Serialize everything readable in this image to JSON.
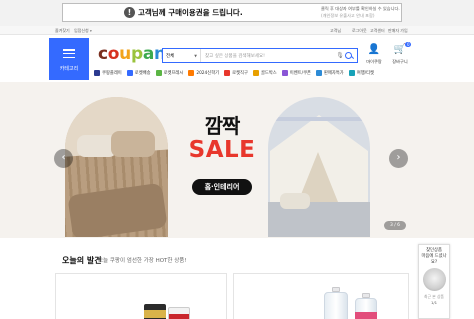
{
  "notice": {
    "icon": "!",
    "title": "고객님께 구매이용권을 드립니다.",
    "line1": "클릭 후 대상자 여부를 확인하실 수 있습니다.",
    "line2": "(개인정보 유출사고 안내 포함)"
  },
  "top_links": {
    "favorites": "즐겨찾기",
    "seller": "입점신청",
    "user": "고객님",
    "logout": "로그아웃",
    "customer_center": "고객센터",
    "seller_apply": "판매자 가입"
  },
  "header": {
    "category_label": "카테고리",
    "logo_letters": [
      {
        "ch": "c",
        "color": "#7a2e1e"
      },
      {
        "ch": "o",
        "color": "#d6301e"
      },
      {
        "ch": "u",
        "color": "#f2a31b"
      },
      {
        "ch": "p",
        "color": "#9ac33c"
      },
      {
        "ch": "a",
        "color": "#3daa50"
      },
      {
        "ch": "n",
        "color": "#2d8bd6"
      },
      {
        "ch": "g",
        "color": "#2d8bd6"
      }
    ],
    "search_select": "전체",
    "search_placeholder": "찾고 싶은 상품을 검색해보세요!",
    "my_label": "마이쿠팡",
    "cart_label": "장바구니",
    "cart_count": "0"
  },
  "quick_nav": [
    {
      "label": "쿠팡플레이",
      "color": "#2b3a8f"
    },
    {
      "label": "로켓배송",
      "color": "#346aff"
    },
    {
      "label": "로켓프레시",
      "color": "#5bb544"
    },
    {
      "label": "2024신학기",
      "color": "#ff7a00"
    },
    {
      "label": "로켓직구",
      "color": "#e8372c"
    },
    {
      "label": "골드박스",
      "color": "#e8a000"
    },
    {
      "label": "이벤트/쿠폰",
      "color": "#8a56d6"
    },
    {
      "label": "판매자특가",
      "color": "#2d8bd6"
    },
    {
      "label": "여행/티켓",
      "color": "#17a2b8"
    }
  ],
  "hero": {
    "title_kr": "깜짝",
    "title_en": "SALE",
    "tag": "홈·인테리어",
    "prev": "‹",
    "next": "›",
    "pager": "3 / 6",
    "sale_color": "#e8372c"
  },
  "discovery": {
    "title": "오늘의 발견",
    "subtitle": "오늘 쿠팡이 엄선한 가장 HOT한 상품!"
  },
  "side_panel": {
    "heading_line1": "찾던상품",
    "heading_line2": "마음에 드셨나요?",
    "caption1": "최근 본 상품",
    "caption2": "1/1"
  }
}
